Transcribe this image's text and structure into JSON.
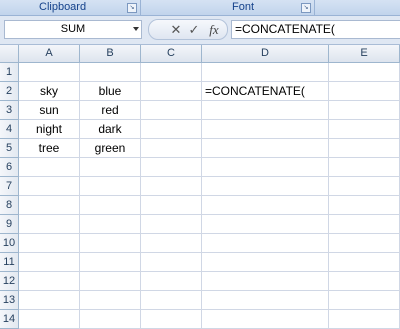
{
  "ribbon": {
    "groups": [
      "Clipboard",
      "Font"
    ]
  },
  "formula_bar": {
    "name_box": "SUM",
    "cancel_icon": "✕",
    "enter_icon": "✓",
    "fx_label": "fx",
    "formula": "=CONCATENATE("
  },
  "columns": [
    "A",
    "B",
    "C",
    "D",
    "E"
  ],
  "rows": [
    "1",
    "2",
    "3",
    "4",
    "5",
    "6",
    "7",
    "8",
    "9",
    "10",
    "11",
    "12",
    "13",
    "14"
  ],
  "cells": {
    "A2": "sky",
    "B2": "blue",
    "D2": "=CONCATENATE(",
    "A3": "sun",
    "B3": "red",
    "A4": "night",
    "B4": "dark",
    "A5": "tree",
    "B5": "green"
  },
  "colors": {
    "ribbon_text": "#15428b",
    "header_text": "#27415f",
    "gridline": "#d0d7e5"
  }
}
